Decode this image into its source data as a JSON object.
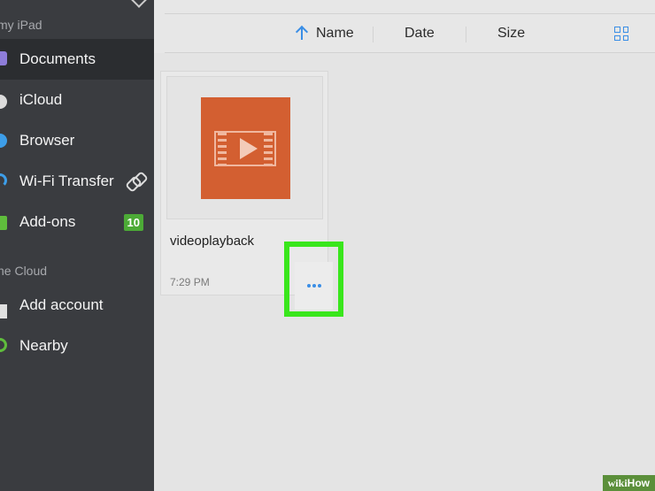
{
  "sidebar": {
    "local_header": "my iPad",
    "cloud_header": "he Cloud",
    "items": [
      {
        "label": "Documents",
        "icon": "folder-icon"
      },
      {
        "label": "iCloud",
        "icon": "cloud-icon"
      },
      {
        "label": "Browser",
        "icon": "globe-icon"
      },
      {
        "label": "Wi-Fi Transfer",
        "icon": "wifi-icon"
      },
      {
        "label": "Add-ons",
        "icon": "cart-icon",
        "badge": "10"
      },
      {
        "label": "Add account",
        "icon": "plus-icon"
      },
      {
        "label": "Nearby",
        "icon": "radar-icon"
      }
    ]
  },
  "toolbar": {
    "sort_name": "Name",
    "sort_date": "Date",
    "sort_size": "Size",
    "view_icon": "grid-view-icon"
  },
  "file": {
    "name": "videoplayback",
    "time": "7:29 PM",
    "thumb_icon": "video-file-icon",
    "more_icon": "more-dots-icon"
  },
  "watermark": {
    "part1": "wiki",
    "part2": "How"
  },
  "colors": {
    "sidebar_bg": "#3a3c40",
    "accent": "#3a8ee6",
    "video_tile": "#d35f31",
    "highlight": "#39e61c",
    "badge": "#4caa36"
  }
}
